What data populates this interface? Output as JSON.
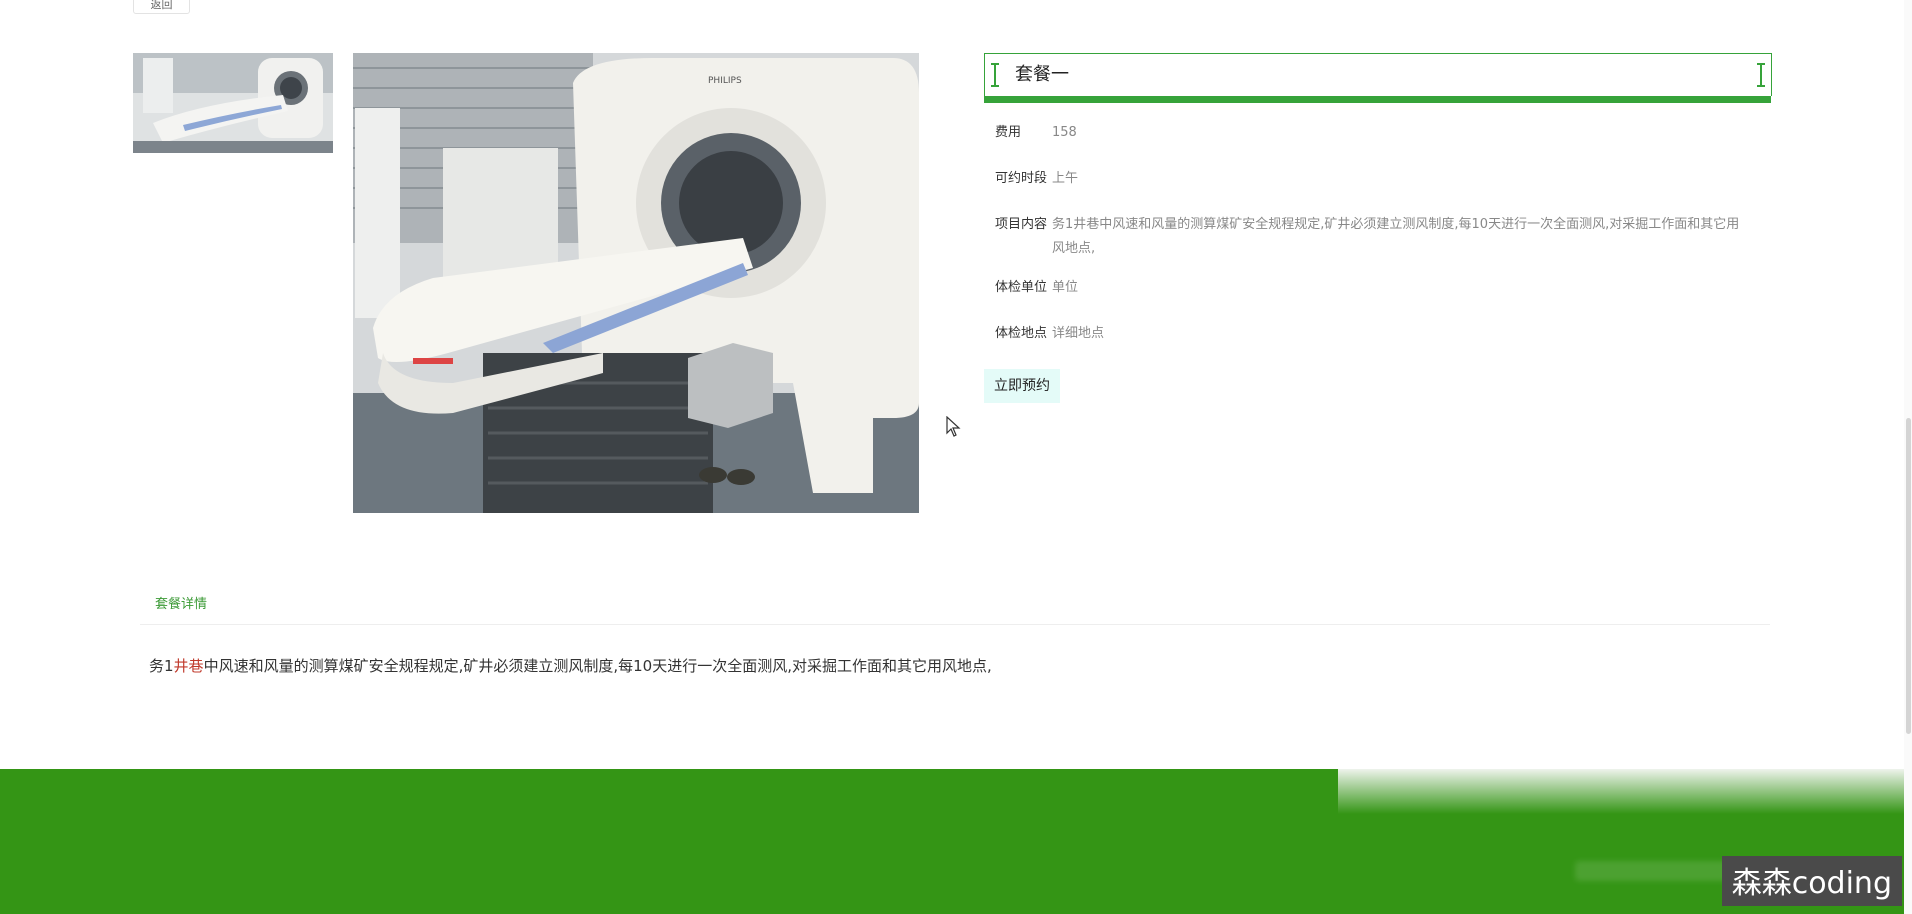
{
  "nav": {
    "back_label": "返回"
  },
  "package": {
    "title": "套餐一",
    "fee": {
      "label": "费用",
      "value": "158"
    },
    "slot": {
      "label": "可约时段",
      "value": "上午"
    },
    "content": {
      "label": "项目内容",
      "value": "务1井巷中风速和风量的测算煤矿安全规程规定,矿井必须建立测风制度,每10天进行一次全面测风,对采掘工作面和其它用风地点,"
    },
    "unit": {
      "label": "体检单位",
      "value": "单位"
    },
    "place": {
      "label": "体检地点",
      "value": "详细地点"
    },
    "book_label": "立即预约"
  },
  "images": {
    "thumbnail_icon": "ct-scanner-thumbnail",
    "main_icon": "ct-scanner-photo",
    "brand_text": "PHILIPS"
  },
  "details": {
    "tab_label": "套餐详情",
    "text_prefix": "务1",
    "text_highlight": "井巷",
    "text_rest": "中风速和风量的测算煤矿安全规程规定,矿井必须建立测风制度,每10天进行一次全面测风,对采掘工作面和其它用风地点,"
  },
  "footer": {
    "watermark": "森森coding"
  },
  "colors": {
    "accent": "#36a33a",
    "footer_bg": "#349515",
    "button_bg": "#e4fbf8",
    "highlight": "#c0392b"
  }
}
